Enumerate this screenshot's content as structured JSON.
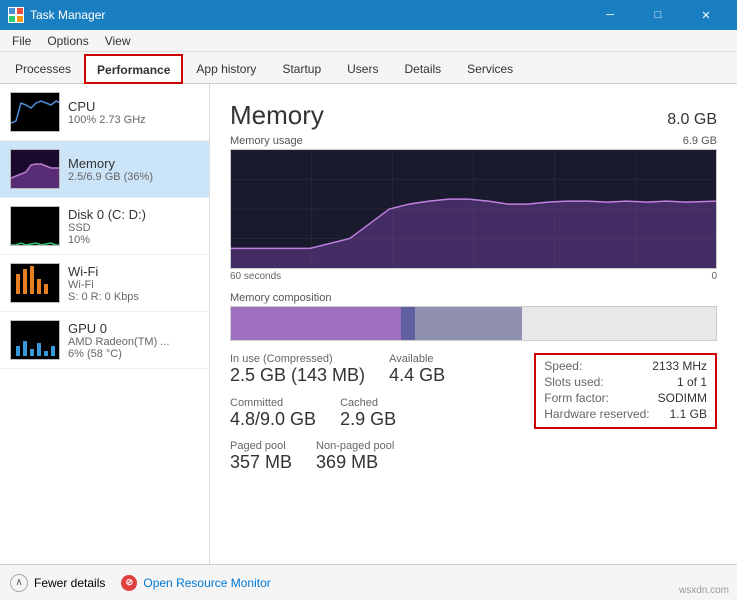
{
  "titlebar": {
    "title": "Task Manager",
    "icon": "tm",
    "min_btn": "─",
    "max_btn": "□",
    "close_btn": "✕"
  },
  "menubar": {
    "items": [
      "File",
      "Options",
      "View"
    ]
  },
  "tabs": [
    {
      "id": "processes",
      "label": "Processes"
    },
    {
      "id": "performance",
      "label": "Performance",
      "active": true
    },
    {
      "id": "app-history",
      "label": "App history"
    },
    {
      "id": "startup",
      "label": "Startup"
    },
    {
      "id": "users",
      "label": "Users"
    },
    {
      "id": "details",
      "label": "Details"
    },
    {
      "id": "services",
      "label": "Services"
    }
  ],
  "sidebar": {
    "items": [
      {
        "id": "cpu",
        "name": "CPU",
        "sub1": "100% 2.73 GHz",
        "color": "#4a90d9"
      },
      {
        "id": "memory",
        "name": "Memory",
        "sub1": "2.5/6.9 GB (36%)",
        "color": "#9b59b6",
        "active": true
      },
      {
        "id": "disk",
        "name": "Disk 0 (C: D:)",
        "sub1": "SSD",
        "sub2": "10%",
        "color": "#2ecc71"
      },
      {
        "id": "wifi",
        "name": "Wi-Fi",
        "sub1": "Wi-Fi",
        "sub2": "S: 0 R: 0 Kbps",
        "color": "#e67e22"
      },
      {
        "id": "gpu",
        "name": "GPU 0",
        "sub1": "AMD Radeon(TM) ...",
        "sub2": "6% (58 °C)",
        "color": "#3498db"
      }
    ]
  },
  "content": {
    "title": "Memory",
    "size": "8.0 GB",
    "graph": {
      "label": "Memory usage",
      "max_label": "6.9 GB",
      "time_label": "60 seconds",
      "min_label": "0"
    },
    "composition_label": "Memory composition",
    "stats": {
      "in_use_label": "In use (Compressed)",
      "in_use_value": "2.5 GB (143 MB)",
      "available_label": "Available",
      "available_value": "4.4 GB",
      "committed_label": "Committed",
      "committed_value": "4.8/9.0 GB",
      "cached_label": "Cached",
      "cached_value": "2.9 GB",
      "paged_label": "Paged pool",
      "paged_value": "357 MB",
      "nonpaged_label": "Non-paged pool",
      "nonpaged_value": "369 MB"
    },
    "specs": {
      "speed_label": "Speed:",
      "speed_value": "2133 MHz",
      "slots_label": "Slots used:",
      "slots_value": "1 of 1",
      "form_label": "Form factor:",
      "form_value": "SODIMM",
      "hw_label": "Hardware reserved:",
      "hw_value": "1.1 GB"
    }
  },
  "bottombar": {
    "fewer_details": "Fewer details",
    "open_monitor": "Open Resource Monitor"
  }
}
